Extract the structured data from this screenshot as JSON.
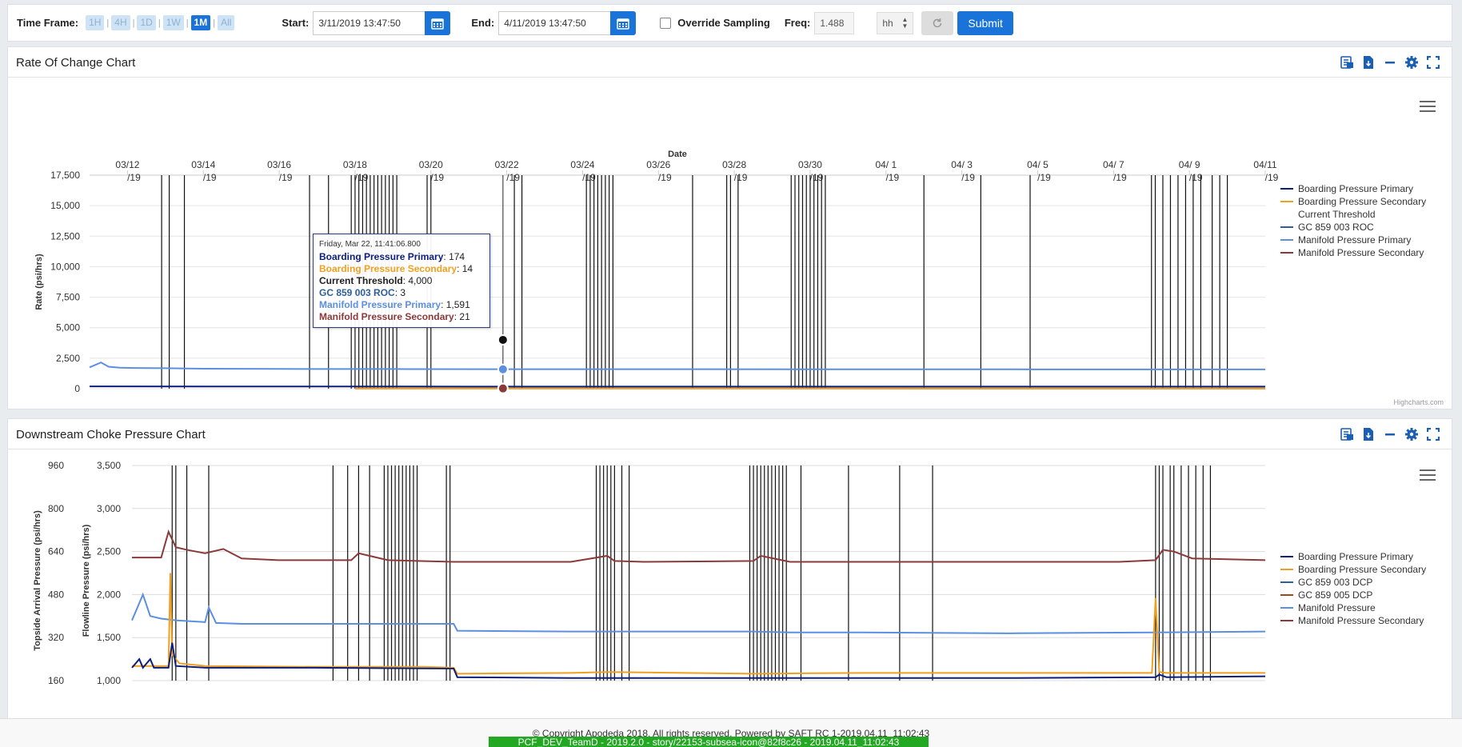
{
  "toolbar": {
    "time_frame_label": "Time Frame:",
    "buttons": [
      "1H",
      "4H",
      "1D",
      "1W",
      "1M",
      "All"
    ],
    "active": "1M",
    "start_label": "Start:",
    "start_value": "3/11/2019 13:47:50",
    "end_label": "End:",
    "end_value": "4/11/2019 13:47:50",
    "override_label": "Override Sampling",
    "freq_label": "Freq:",
    "freq_value": "1.488",
    "unit_value": "hh",
    "submit_label": "Submit"
  },
  "colors": {
    "navy": "#0b1e7a",
    "orange": "#f0a020",
    "black": "#222222",
    "steel": "#2f5f9a",
    "light_blue": "#5b8fe0",
    "maroon": "#8b3a3a",
    "brown": "#9a4a1a",
    "accent": "#1a73d9"
  },
  "rate_panel": {
    "title": "Rate Of Change Chart",
    "credit": "Highcharts.com",
    "legend": [
      {
        "name": "Boarding Pressure Primary",
        "color": "#0b1e7a"
      },
      {
        "name": "Boarding Pressure Secondary",
        "color": "#f0a020"
      },
      {
        "name": "Current Threshold",
        "color": ""
      },
      {
        "name": "GC 859 003 ROC",
        "color": "#2f5f9a"
      },
      {
        "name": "Manifold Pressure Primary",
        "color": "#5b8fe0"
      },
      {
        "name": "Manifold Pressure Secondary",
        "color": "#8b3a3a"
      }
    ],
    "tooltip": {
      "date": "Friday, Mar 22, 11:41:06.800",
      "rows": [
        {
          "label": "Boarding Pressure Primary",
          "value": "174",
          "color": "#0b1e7a"
        },
        {
          "label": "Boarding Pressure Secondary",
          "value": "14",
          "color": "#f0a020"
        },
        {
          "label": "Current Threshold",
          "value": "4,000",
          "color": "#222222"
        },
        {
          "label": "GC 859 003 ROC",
          "value": "3",
          "color": "#2f5f9a"
        },
        {
          "label": "Manifold Pressure Primary",
          "value": "1,591",
          "color": "#5b8fe0"
        },
        {
          "label": "Manifold Pressure Secondary",
          "value": "21",
          "color": "#8b3a3a"
        }
      ]
    }
  },
  "choke_panel": {
    "title": "Downstream Choke Pressure Chart",
    "legend": [
      {
        "name": "Boarding Pressure Primary",
        "color": "#0b1e7a"
      },
      {
        "name": "Boarding Pressure Secondary",
        "color": "#f0a020"
      },
      {
        "name": "GC 859 003 DCP",
        "color": "#2f5f9a"
      },
      {
        "name": "GC 859 005 DCP",
        "color": "#9a4a1a"
      },
      {
        "name": "Manifold Pressure",
        "color": "#5b8fe0"
      },
      {
        "name": "Manifold Pressure Secondary",
        "color": "#8b3a3a"
      }
    ]
  },
  "footer": {
    "copyright": "© Copyright Apodeda 2018. All rights reserved. Powered by SAFT  RC 1-2019.04.11_11:02:43",
    "env_banner": "PCF_DEV_TeamD - 2019.2.0 - story/22153-subsea-icon@82f8c26 - 2019.04.11_11:02:43"
  },
  "chart_data": [
    {
      "type": "line",
      "title": "Rate Of Change Chart",
      "xlabel": "Date",
      "ylabel": "Rate (psi/hrs)",
      "x_ticks": [
        "03/12 /19",
        "03/14 /19",
        "03/16 /19",
        "03/18 /19",
        "03/20 /19",
        "03/22 /19",
        "03/24 /19",
        "03/26 /19",
        "03/28 /19",
        "03/30 /19",
        "04/ 1 /19",
        "04/ 3 /19",
        "04/ 5 /19",
        "04/ 7 /19",
        "04/ 9 /19",
        "04/11 /19"
      ],
      "x_range_days": [
        0,
        31
      ],
      "ylim": [
        0,
        17500
      ],
      "y_ticks": [
        0,
        2500,
        5000,
        7500,
        10000,
        12500,
        15000,
        17500
      ],
      "event_markers_day": [
        1.9,
        2.1,
        2.5,
        5.8,
        6.3,
        6.9,
        7.0,
        7.1,
        7.2,
        7.3,
        7.4,
        7.5,
        7.6,
        7.7,
        7.8,
        7.9,
        8.0,
        8.1,
        8.9,
        9.0,
        11.2,
        11.4,
        13.1,
        13.2,
        13.3,
        13.4,
        13.5,
        13.6,
        13.7,
        13.8,
        15.9,
        16.8,
        16.9,
        17.1,
        18.5,
        18.6,
        18.7,
        18.8,
        18.9,
        19.0,
        19.1,
        19.2,
        19.3,
        19.4,
        22.0,
        23.5,
        24.8,
        28.0,
        28.1,
        28.3,
        28.5,
        28.7,
        28.9,
        29.1,
        29.3,
        29.6,
        29.8,
        30.0
      ],
      "series": [
        {
          "name": "Manifold Pressure Primary",
          "x": [
            0,
            0.3,
            0.5,
            0.8,
            1.2,
            2,
            3,
            5,
            8,
            11,
            15,
            20,
            25,
            31
          ],
          "y": [
            1750,
            2150,
            1800,
            1720,
            1700,
            1680,
            1640,
            1620,
            1610,
            1600,
            1595,
            1590,
            1585,
            1580
          ]
        },
        {
          "name": "Boarding Pressure Primary",
          "x": [
            0,
            5,
            10,
            15,
            20,
            25,
            31
          ],
          "y": [
            190,
            180,
            175,
            174,
            172,
            170,
            168
          ]
        },
        {
          "name": "Manifold Pressure Secondary",
          "x": [
            7,
            12,
            17,
            22,
            27,
            31
          ],
          "y": [
            25,
            22,
            21,
            20,
            20,
            20
          ]
        },
        {
          "name": "Boarding Pressure Secondary",
          "x": [
            7,
            12,
            17,
            22,
            27,
            31
          ],
          "y": [
            15,
            14,
            14,
            13,
            13,
            13
          ]
        }
      ],
      "tooltip_day": 10.9,
      "legend_position": "right"
    },
    {
      "type": "line",
      "title": "Downstream Choke Pressure Chart",
      "ylabel_left": "Topside Arrival Pressure (psi/hrs)",
      "ylabel_right": "Flowline Pressure (psi/hrs)",
      "y_ticks_left": [
        160,
        320,
        480,
        640,
        800,
        960
      ],
      "y_ticks_flowline": [
        1000,
        1500,
        2000,
        2500,
        3000,
        3500
      ],
      "ylim_flowline": [
        1000,
        3500
      ],
      "event_markers_day": [
        1.1,
        1.2,
        1.5,
        2.1,
        5.5,
        5.9,
        6.2,
        6.5,
        6.9,
        7.0,
        7.1,
        7.2,
        7.3,
        7.4,
        7.5,
        7.6,
        7.7,
        7.8,
        8.6,
        8.7,
        12.7,
        12.8,
        12.9,
        13.0,
        13.1,
        13.2,
        13.4,
        13.6,
        16.9,
        17.0,
        17.1,
        17.2,
        17.3,
        17.4,
        17.5,
        17.6,
        17.7,
        17.8,
        17.9,
        18.3,
        19.6,
        21.0,
        21.9,
        28.0,
        28.1,
        28.2,
        28.4,
        28.5,
        28.7,
        28.9,
        29.1,
        29.3,
        29.5
      ],
      "series": [
        {
          "name": "Manifold Pressure Secondary",
          "x": [
            0,
            0.8,
            1.0,
            1.2,
            1.5,
            2,
            2.5,
            3,
            4,
            6,
            6.2,
            6.5,
            7,
            8.8,
            12,
            13,
            13.2,
            14,
            17,
            17.2,
            18,
            21,
            24,
            27,
            28,
            28.2,
            28.5,
            29,
            31
          ],
          "y": [
            2430,
            2430,
            2730,
            2550,
            2520,
            2480,
            2530,
            2420,
            2400,
            2400,
            2480,
            2450,
            2400,
            2380,
            2380,
            2450,
            2390,
            2380,
            2390,
            2450,
            2380,
            2380,
            2380,
            2380,
            2400,
            2520,
            2500,
            2420,
            2400
          ]
        },
        {
          "name": "Manifold Pressure",
          "x": [
            0,
            0.3,
            0.5,
            0.8,
            1.2,
            2,
            2.1,
            2.3,
            3,
            5,
            8,
            8.8,
            8.9,
            12,
            17,
            18,
            20,
            24,
            28,
            31
          ],
          "y": [
            1700,
            2000,
            1750,
            1720,
            1700,
            1680,
            1850,
            1670,
            1660,
            1660,
            1660,
            1660,
            1580,
            1570,
            1570,
            1560,
            1560,
            1550,
            1560,
            1570
          ]
        },
        {
          "name": "Boarding Pressure Secondary",
          "x": [
            0,
            1.0,
            1.05,
            1.1,
            1.3,
            2,
            5,
            8,
            8.8,
            8.9,
            12,
            13,
            17,
            20,
            24,
            27.9,
            28.0,
            28.1,
            28.3,
            31
          ],
          "y": [
            1170,
            1170,
            2250,
            1300,
            1200,
            1170,
            1160,
            1160,
            1150,
            1080,
            1090,
            1100,
            1080,
            1090,
            1090,
            1090,
            1960,
            1100,
            1090,
            1090
          ]
        },
        {
          "name": "Boarding Pressure Primary",
          "x": [
            0,
            0.2,
            0.3,
            0.5,
            0.6,
            1.0,
            1.1,
            1.2,
            2,
            5,
            8.8,
            8.9,
            12,
            17,
            24,
            28,
            28.1,
            28.3,
            31
          ],
          "y": [
            1150,
            1250,
            1150,
            1250,
            1150,
            1150,
            1440,
            1170,
            1150,
            1150,
            1140,
            1040,
            1030,
            1030,
            1030,
            1040,
            1070,
            1040,
            1050
          ]
        }
      ],
      "legend_position": "right"
    }
  ]
}
